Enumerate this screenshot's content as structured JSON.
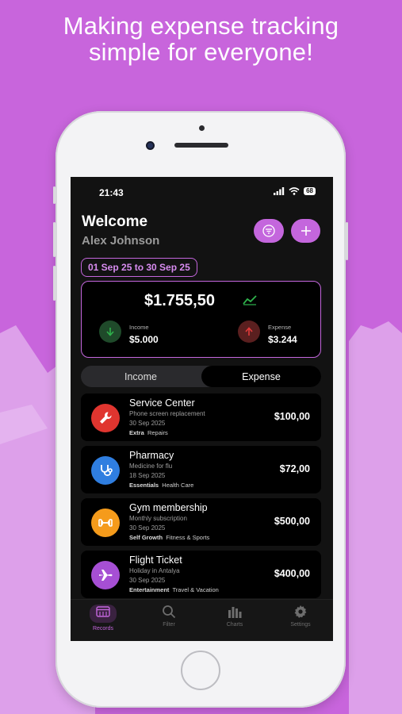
{
  "headline": {
    "line1": "Making expense tracking",
    "line2": "simple for everyone!"
  },
  "colors": {
    "background": "#c865dc",
    "accent": "#c466dd",
    "income_green": "#2fb24c",
    "expense_red": "#e23b3b"
  },
  "status_bar": {
    "time": "21:43",
    "battery": "68"
  },
  "header": {
    "welcome": "Welcome",
    "user_name": "Alex Johnson",
    "filter_icon": "filter-icon",
    "add_icon": "plus-icon"
  },
  "date_range": "01 Sep 25 to 30 Sep 25",
  "summary": {
    "balance": "$1.755,50",
    "income_label": "Income",
    "income_value": "$5.000",
    "expense_label": "Expense",
    "expense_value": "$3.244"
  },
  "toggle": {
    "income": "Income",
    "expense": "Expense",
    "selected": "Expense"
  },
  "transactions": [
    {
      "title": "Service Center",
      "description": "Phone screen replacement",
      "date": "30 Sep 2025",
      "tag_main": "Extra",
      "tag_sub": "Repairs",
      "amount": "$100,00",
      "icon": "wrench-icon",
      "icon_color": "#e0352f"
    },
    {
      "title": "Pharmacy",
      "description": "Medicine for flu",
      "date": "18 Sep 2025",
      "tag_main": "Essentials",
      "tag_sub": "Health Care",
      "amount": "$72,00",
      "icon": "stethoscope-icon",
      "icon_color": "#2f7ee0"
    },
    {
      "title": "Gym membership",
      "description": "Monthly subscription",
      "date": "30 Sep 2025",
      "tag_main": "Self Growth",
      "tag_sub": "Fitness & Sports",
      "amount": "$500,00",
      "icon": "dumbbell-icon",
      "icon_color": "#f59b1b"
    },
    {
      "title": "Flight Ticket",
      "description": "Holiday in Antalya",
      "date": "30 Sep 2025",
      "tag_main": "Entertainment",
      "tag_sub": "Travel & Vacation",
      "amount": "$400,00",
      "icon": "airplane-icon",
      "icon_color": "#a64fd4"
    }
  ],
  "tab_bar": [
    {
      "label": "Records",
      "icon": "records-icon",
      "active": true
    },
    {
      "label": "Filter",
      "icon": "search-icon",
      "active": false
    },
    {
      "label": "Charts",
      "icon": "bar-chart-icon",
      "active": false
    },
    {
      "label": "Settings",
      "icon": "gear-icon",
      "active": false
    }
  ]
}
